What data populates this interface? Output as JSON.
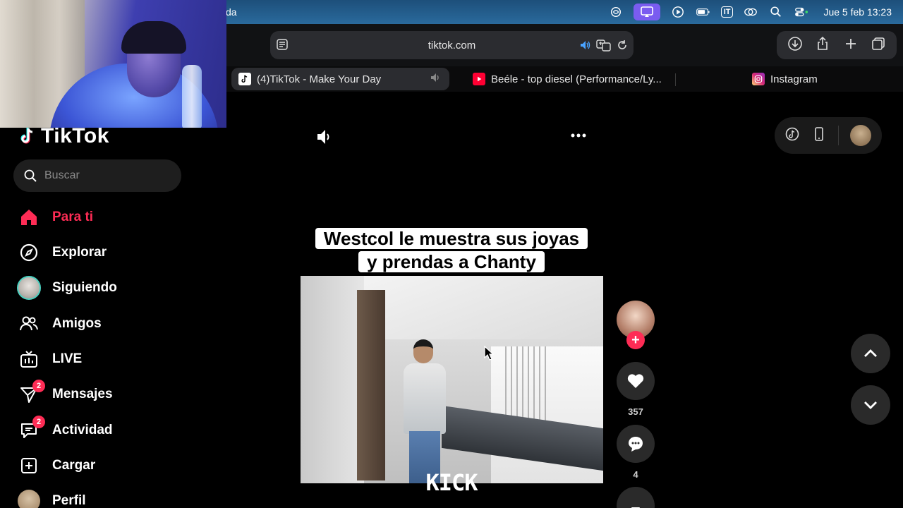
{
  "menubar": {
    "app_fragment": "da",
    "input_source": "IT",
    "clock": "Jue 5 feb 13:23"
  },
  "browser": {
    "url": "tiktok.com",
    "tabs": [
      {
        "label": "(4)TikTok - Make Your Day",
        "active": true
      },
      {
        "label": "Beéle - top diesel (Performance/Ly...",
        "active": false
      },
      {
        "label": "Instagram",
        "active": false
      }
    ]
  },
  "sidebar": {
    "brand": "TikTok",
    "search_placeholder": "Buscar",
    "items": [
      {
        "label": "Para ti",
        "icon": "home-icon",
        "active": true
      },
      {
        "label": "Explorar",
        "icon": "compass-icon"
      },
      {
        "label": "Siguiendo",
        "icon": "following-avatar"
      },
      {
        "label": "Amigos",
        "icon": "friends-icon"
      },
      {
        "label": "LIVE",
        "icon": "live-icon"
      },
      {
        "label": "Mensajes",
        "icon": "messages-icon",
        "badge": "2"
      },
      {
        "label": "Actividad",
        "icon": "activity-icon",
        "badge": "2"
      },
      {
        "label": "Cargar",
        "icon": "upload-icon"
      },
      {
        "label": "Perfil",
        "icon": "profile-avatar"
      }
    ]
  },
  "video": {
    "caption_line1": "Westcol le muestra sus joyas",
    "caption_line2": "y prendas a Chanty",
    "watermark": "KICK",
    "likes": "357",
    "comments": "4"
  },
  "colors": {
    "accent": "#fe2c55",
    "menubar": "#245f8f",
    "panel": "#2b2c30"
  }
}
